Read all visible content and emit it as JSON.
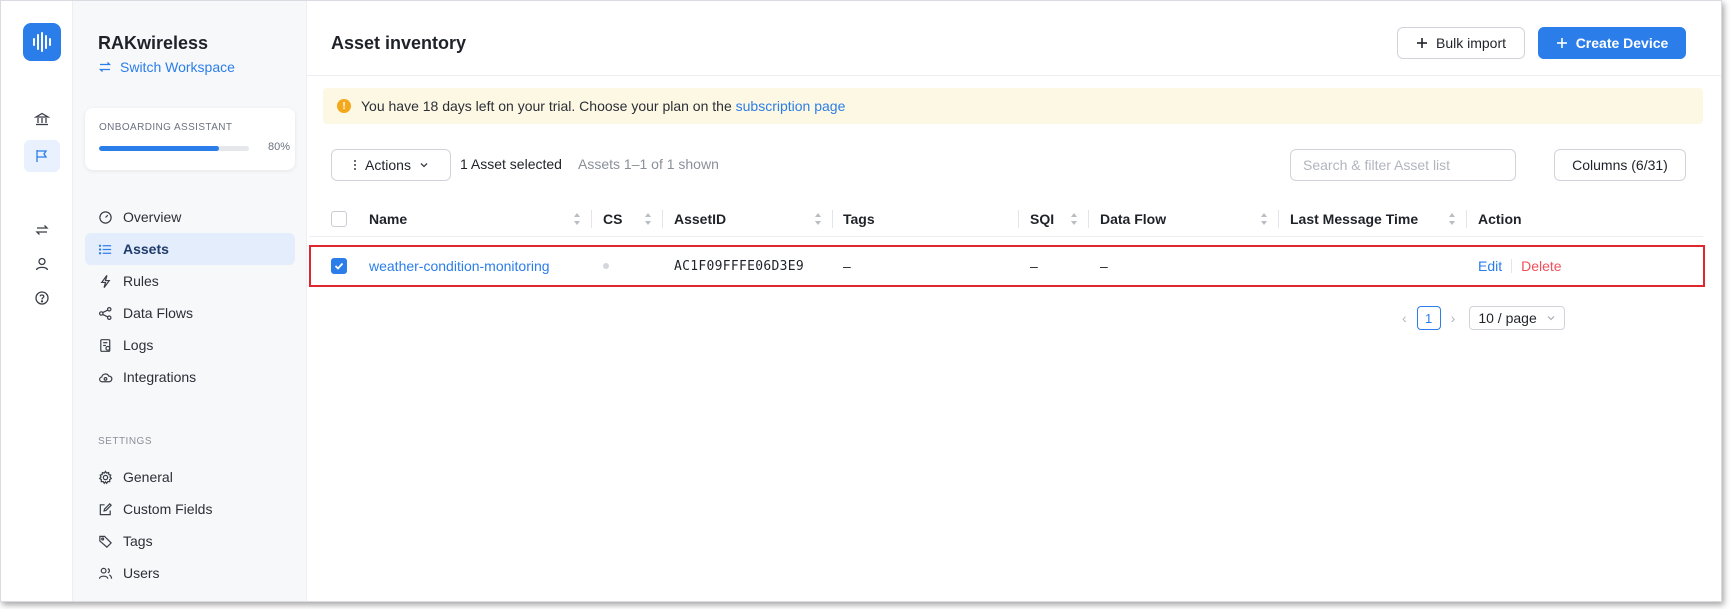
{
  "workspace": {
    "name": "RAKwireless",
    "switch_label": "Switch Workspace"
  },
  "onboarding": {
    "label": "ONBOARDING ASSISTANT",
    "progress_fraction": 0.8,
    "progress_label": "80%"
  },
  "sidebar": {
    "items": [
      {
        "label": "Overview",
        "icon": "gauge-icon"
      },
      {
        "label": "Assets",
        "icon": "list-icon",
        "active": true
      },
      {
        "label": "Rules",
        "icon": "lightning-icon"
      },
      {
        "label": "Data Flows",
        "icon": "share-nodes-icon"
      },
      {
        "label": "Logs",
        "icon": "log-file-icon"
      },
      {
        "label": "Integrations",
        "icon": "cloud-sync-icon"
      }
    ],
    "settings_label": "SETTINGS",
    "settings_items": [
      {
        "label": "General",
        "icon": "gear-icon"
      },
      {
        "label": "Custom Fields",
        "icon": "edit-box-icon"
      },
      {
        "label": "Tags",
        "icon": "tag-icon"
      },
      {
        "label": "Users",
        "icon": "users-icon"
      }
    ]
  },
  "rail": {
    "icons": [
      "bank-icon",
      "flag-icon",
      "swap-icon",
      "user-icon",
      "help-circle-icon"
    ]
  },
  "header": {
    "title": "Asset inventory",
    "bulk_import_label": "Bulk import",
    "create_device_label": "Create Device"
  },
  "alert": {
    "text": "You have 18 days left on your trial. Choose your plan on the",
    "link_text": "subscription page"
  },
  "toolbar": {
    "actions_label": "Actions",
    "selected_text": "1 Asset selected",
    "shown_text": "Assets 1–1 of 1 shown",
    "search_placeholder": "Search & filter Asset list",
    "columns_label": "Columns (6/31)"
  },
  "table": {
    "columns": [
      "Name",
      "CS",
      "AssetID",
      "Tags",
      "SQI",
      "Data Flow",
      "Last Message Time",
      "Action"
    ],
    "rows": [
      {
        "selected": true,
        "name": "weather-condition-monitoring",
        "cs": "",
        "asset_id": "AC1F09FFFE06D3E9",
        "tags": "–",
        "sqi": "–",
        "data_flow": "–",
        "last_message_time": "",
        "edit_label": "Edit",
        "delete_label": "Delete"
      }
    ]
  },
  "pagination": {
    "current_page": "1",
    "page_size": "10 / page"
  },
  "colors": {
    "accent": "#2b7de9",
    "danger": "#f0505a",
    "warning": "#f4a81b",
    "highlight_border": "#e0262f"
  }
}
